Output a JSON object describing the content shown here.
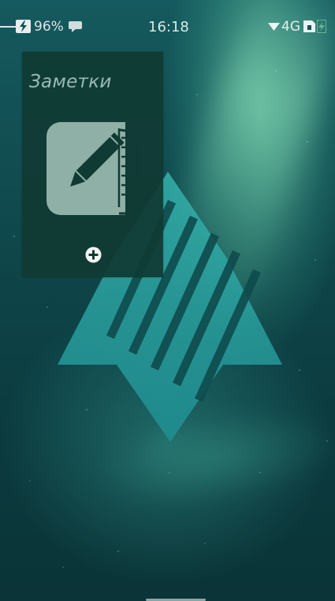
{
  "status_bar": {
    "battery": "96%",
    "time": "16:18",
    "network": "4G",
    "icons": [
      "battery-charging-icon",
      "chat-icon",
      "wifi-icon",
      "sim-icon",
      "battery-charge-icon"
    ]
  },
  "cover": {
    "title": "Заметки",
    "icon": "notes-pencil-icon",
    "action_icon": "plus-circle-icon"
  },
  "wallpaper": {
    "logo": "sailfish-logo",
    "colors": {
      "base": "#0e4549",
      "aurora": "#96ffc8",
      "logo": "#2aa6a4"
    }
  }
}
